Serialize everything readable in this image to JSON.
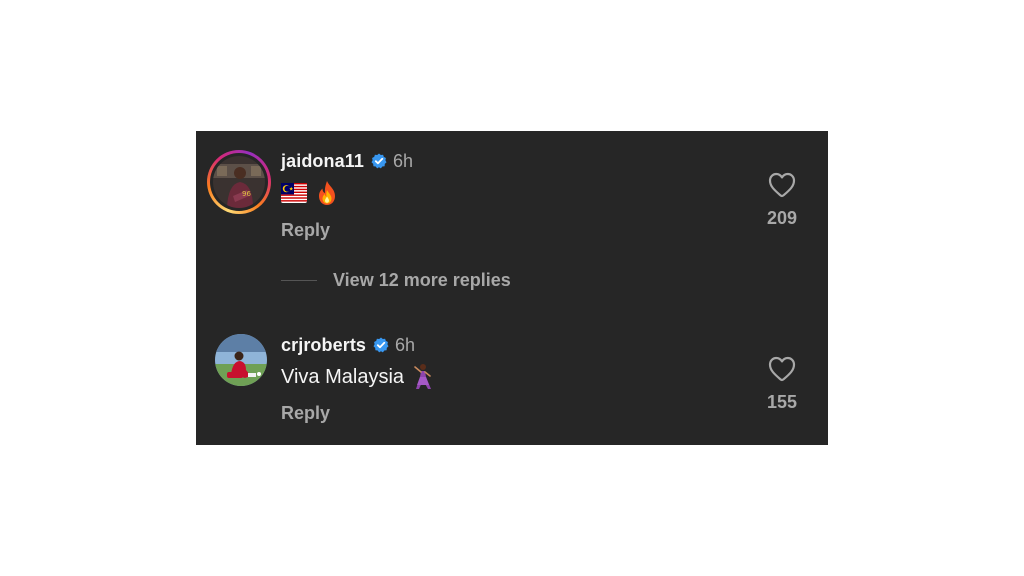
{
  "comments": [
    {
      "username": "jaidona11",
      "verified": true,
      "time": "6h",
      "emojis": [
        "flag-malaysia",
        "fire"
      ],
      "text": "",
      "reply_label": "Reply",
      "like_count": "209",
      "has_story_ring": true
    },
    {
      "username": "crjroberts",
      "verified": true,
      "time": "6h",
      "text": "Viva Malaysia",
      "emojis": [
        "dancer"
      ],
      "reply_label": "Reply",
      "like_count": "155",
      "has_story_ring": false
    }
  ],
  "view_replies": {
    "label": "View 12 more replies"
  },
  "colors": {
    "panel_bg": "#262626",
    "primary_text": "#f5f5f5",
    "secondary_text": "#a8a8a8",
    "verified_blue": "#3897f0"
  },
  "icons": {
    "verified": "verified-badge-icon",
    "like": "heart-outline-icon"
  }
}
